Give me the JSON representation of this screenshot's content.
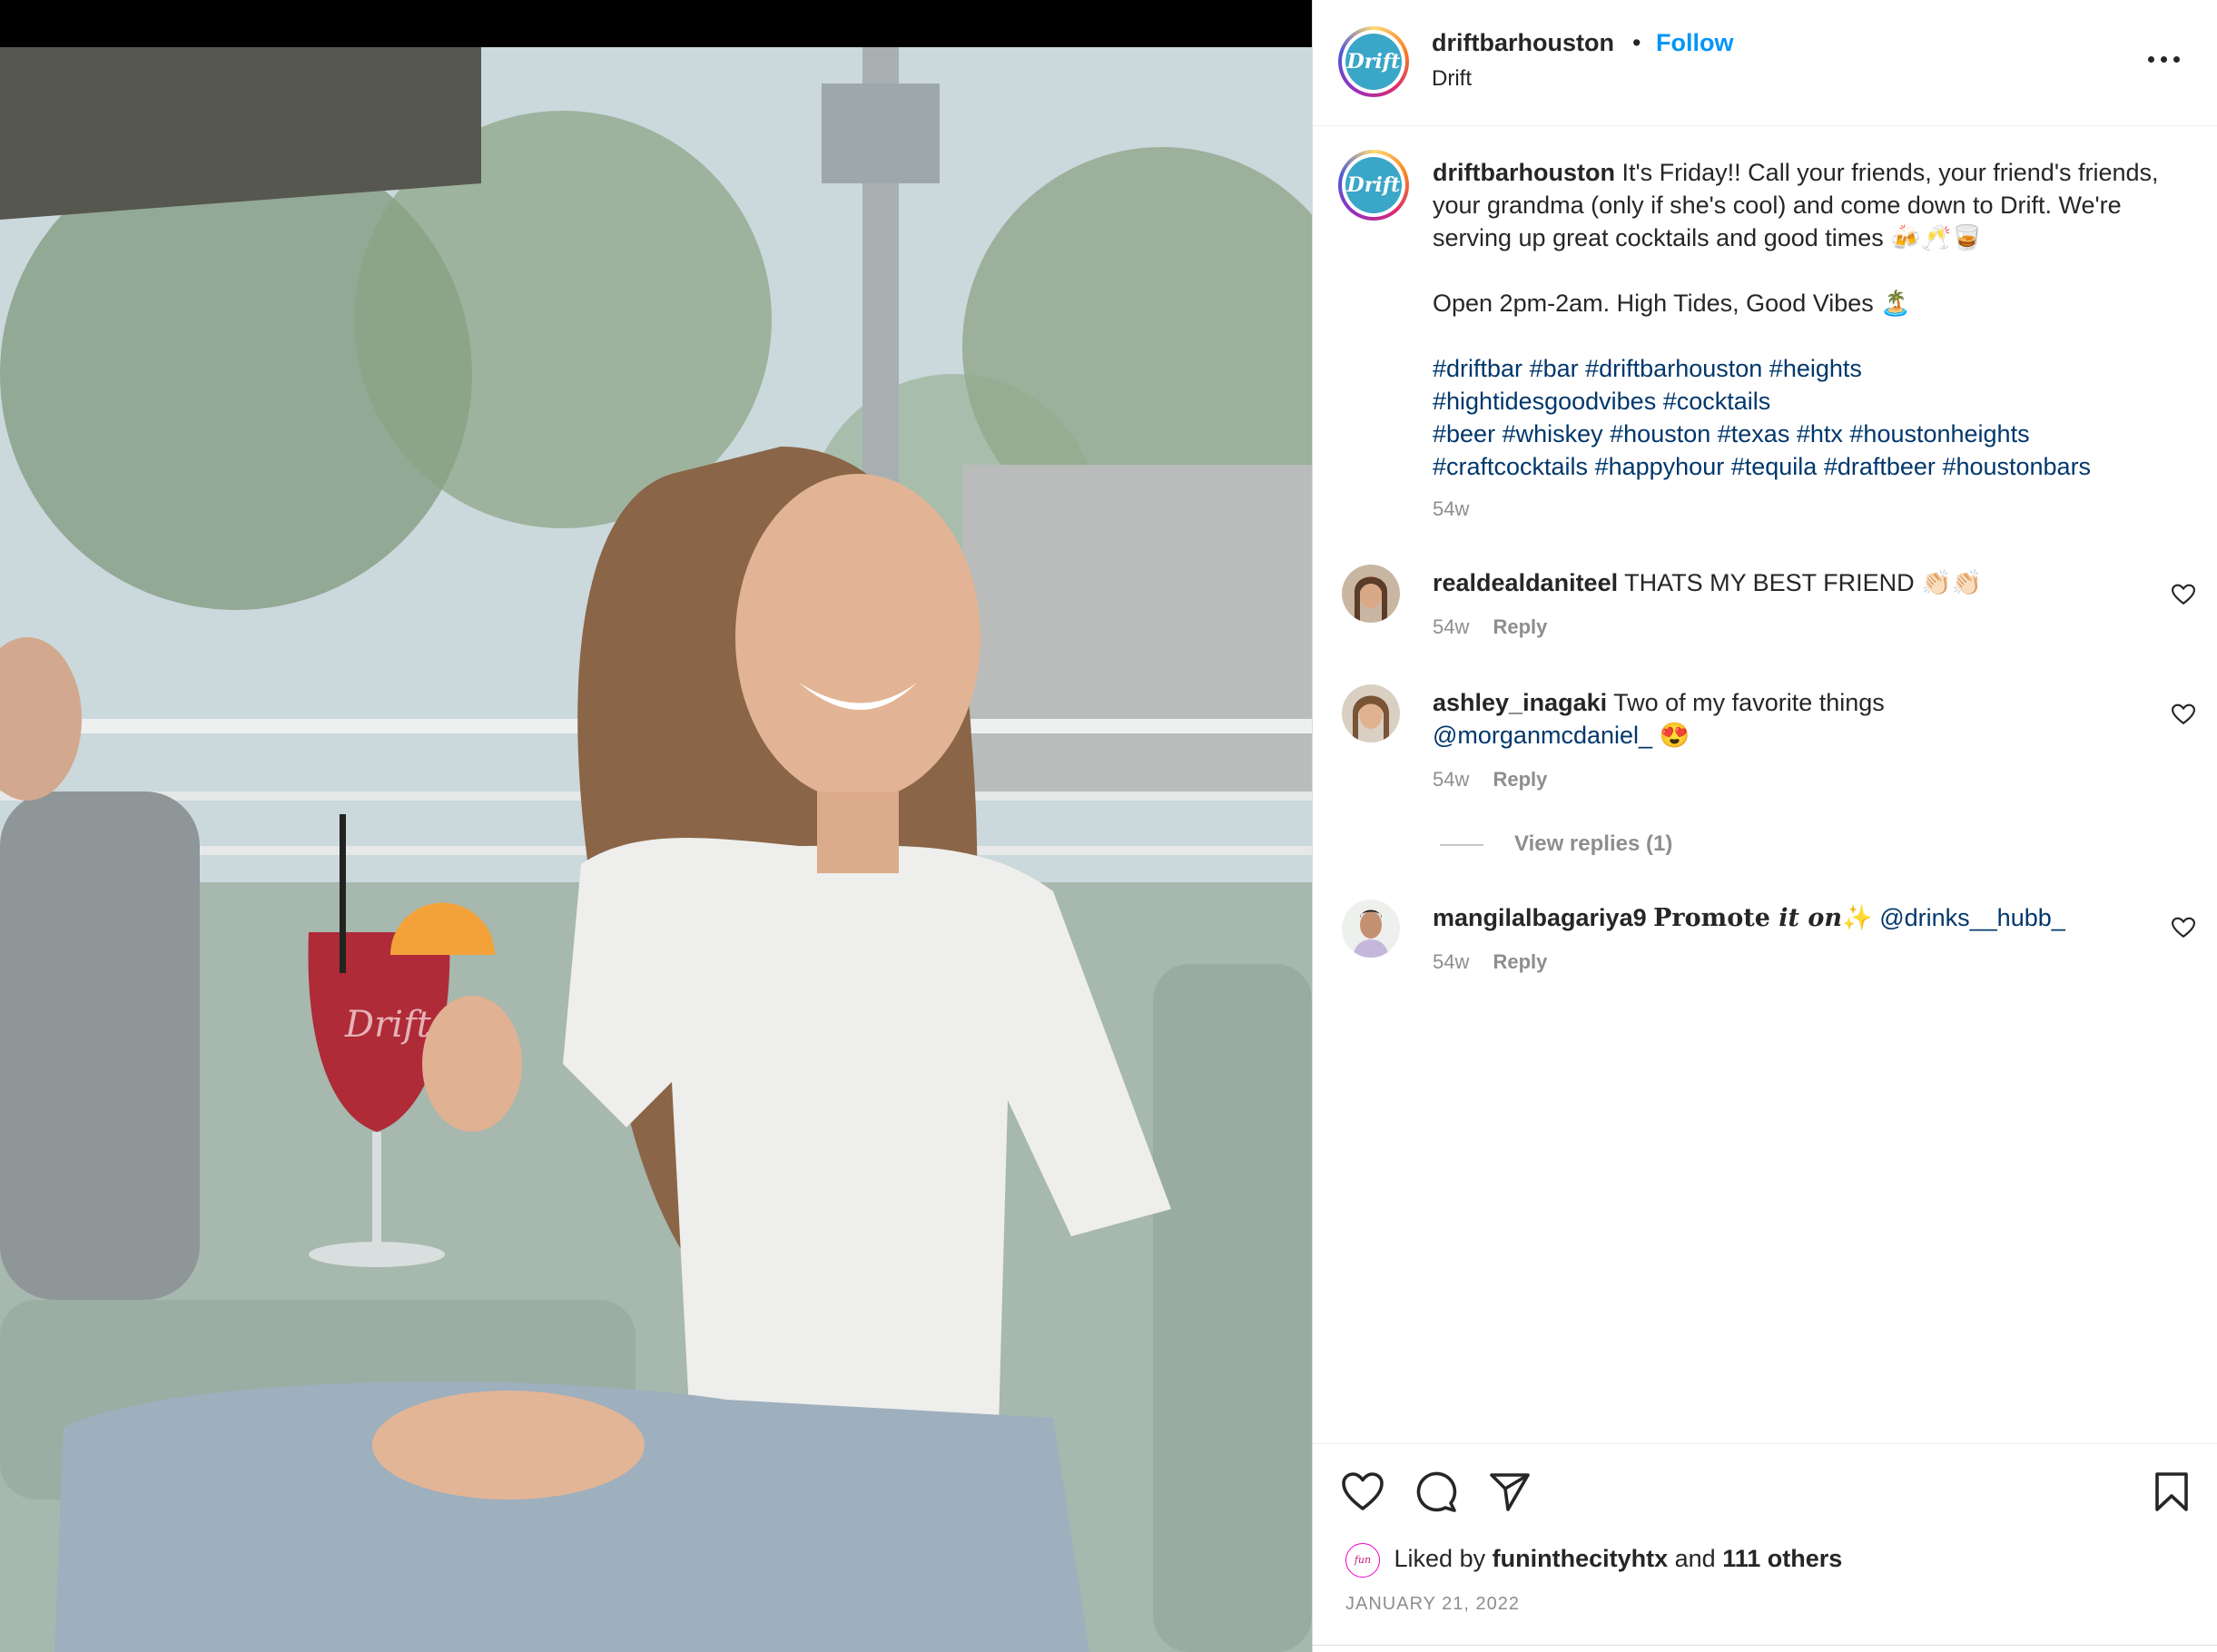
{
  "post": {
    "username": "driftbarhouston",
    "separator": "•",
    "follow_label": "Follow",
    "location": "Drift",
    "avatar_text": "Drift"
  },
  "caption": {
    "username": "driftbarhouston",
    "text": "It's Friday!! Call your friends, your friend's friends, your grandma (only if she's cool) and come down to Drift. We're serving up great cocktails and good times 🍻🥂🥃",
    "line2": "Open 2pm-2am. High Tides, Good Vibes 🏝️",
    "hashtag_lines": [
      [
        "#driftbar",
        "#bar",
        "#driftbarhouston",
        "#heights"
      ],
      [
        "#hightidesgoodvibes",
        "#cocktails"
      ],
      [
        "#beer",
        "#whiskey",
        "#houston",
        "#texas",
        "#htx",
        "#houstonheights"
      ],
      [
        "#craftcocktails",
        "#happyhour",
        "#tequila",
        "#draftbeer",
        "#houstonbars"
      ]
    ],
    "time": "54w"
  },
  "comments": [
    {
      "username": "realdealdaniteel",
      "text": "THATS MY BEST FRIEND 👏🏻👏🏻",
      "time": "54w",
      "reply_label": "Reply"
    },
    {
      "username": "ashley_inagaki",
      "text": "Two of my favorite things",
      "mention": "@morganmcdaniel_",
      "emoji": "😍",
      "time": "54w",
      "reply_label": "Reply"
    },
    {
      "username": "mangilalbagariya9",
      "promote_a": "Promote ",
      "promote_b": "it on",
      "sparkle": "✨",
      "mention": "@drinks__hubb_",
      "time": "54w",
      "reply_label": "Reply"
    }
  ],
  "view_replies_label": "View replies (1)",
  "likes": {
    "prefix": "Liked by",
    "user": "funinthecityhtx",
    "and": "and",
    "others": "111 others",
    "avatar_text": "fun"
  },
  "date": "JANUARY 21, 2022",
  "icons": [
    "more-icon",
    "heart-icon",
    "comment-icon",
    "share-icon",
    "bookmark-icon"
  ]
}
